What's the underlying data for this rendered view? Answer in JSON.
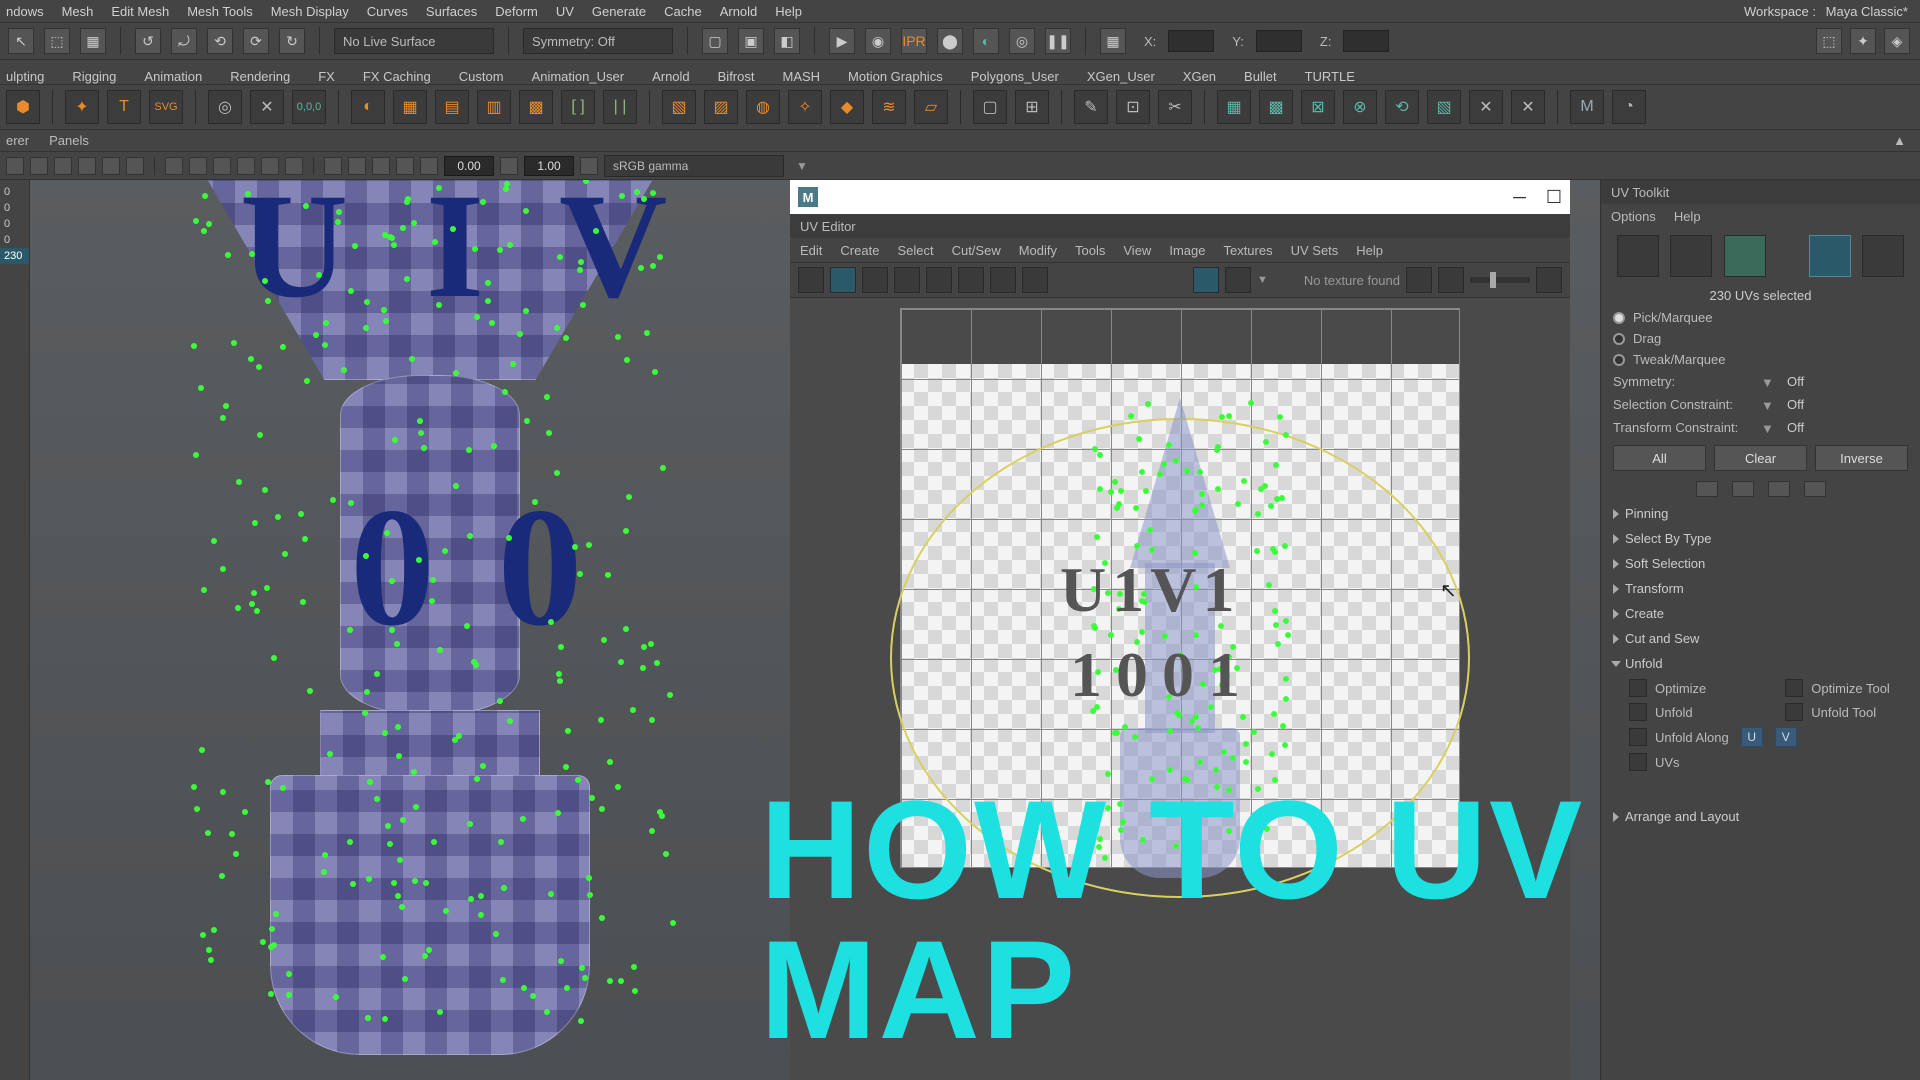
{
  "workspace_label": "Workspace :",
  "workspace_value": "Maya Classic*",
  "main_menu": [
    "ndows",
    "Mesh",
    "Edit Mesh",
    "Mesh Tools",
    "Mesh Display",
    "Curves",
    "Surfaces",
    "Deform",
    "UV",
    "Generate",
    "Cache",
    "Arnold",
    "Help"
  ],
  "status_row": {
    "live_surface": "No Live Surface",
    "symmetry": "Symmetry: Off",
    "axis": [
      "X:",
      "Y:",
      "Z:"
    ]
  },
  "module_tabs": [
    "ulpting",
    "Rigging",
    "Animation",
    "Rendering",
    "FX",
    "FX Caching",
    "Custom",
    "Animation_User",
    "Arnold",
    "Bifrost",
    "MASH",
    "Motion Graphics",
    "Polygons_User",
    "XGen_User",
    "XGen",
    "Bullet",
    "TURTLE"
  ],
  "panel_strip": [
    "erer",
    "Panels"
  ],
  "vp_toolbar": {
    "v1": "0.00",
    "v2": "1.00",
    "gamma": "sRGB gamma"
  },
  "gutter": [
    "0",
    "0",
    "0",
    "0",
    "230"
  ],
  "viewport": {
    "top_text": "U I V",
    "mid_text": "0 0"
  },
  "uv_editor": {
    "title": "UV Editor",
    "menus": [
      "Edit",
      "Create",
      "Select",
      "Cut/Sew",
      "Modify",
      "Tools",
      "View",
      "Image",
      "Textures",
      "UV Sets",
      "Help"
    ],
    "no_tex": "No texture found",
    "tile_label1": "U1V1",
    "tile_label2": "1001"
  },
  "toolkit": {
    "title": "UV Toolkit",
    "menus": [
      "Options",
      "Help"
    ],
    "status": "230 UVs selected",
    "modes": [
      "Pick/Marquee",
      "Drag",
      "Tweak/Marquee"
    ],
    "symmetry_label": "Symmetry:",
    "symmetry_val": "Off",
    "selc_label": "Selection Constraint:",
    "selc_val": "Off",
    "tranc_label": "Transform Constraint:",
    "tranc_val": "Off",
    "btns": [
      "All",
      "Clear",
      "Inverse"
    ],
    "sections": [
      "Pinning",
      "Select By Type",
      "Soft Selection",
      "Transform",
      "Create",
      "Cut and Sew",
      "Unfold"
    ],
    "unfold_items": {
      "optimize": "Optimize",
      "optimize_tool": "Optimize Tool",
      "unfold": "Unfold",
      "unfold_tool": "Unfold Tool",
      "unfold_along": "Unfold Along",
      "u": "U",
      "v": "V",
      "uvs": "UVs",
      "arrange": "Arrange and Layout"
    }
  },
  "overlay": "HOW TO UV MAP"
}
